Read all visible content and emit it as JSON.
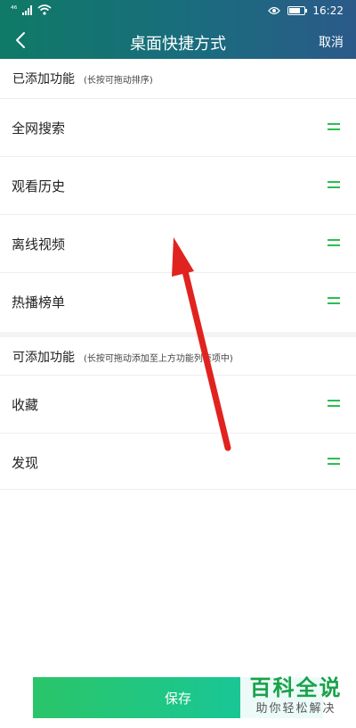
{
  "status_bar": {
    "network": "⁴⁶",
    "time": "16:22"
  },
  "navbar": {
    "title": "桌面快捷方式",
    "cancel_label": "取消"
  },
  "added_section": {
    "title": "已添加功能",
    "hint": "(长按可拖动排序)",
    "items": [
      {
        "label": "全网搜索"
      },
      {
        "label": "观看历史"
      },
      {
        "label": "离线视频"
      },
      {
        "label": "热播榜单"
      }
    ]
  },
  "available_section": {
    "title": "可添加功能",
    "hint": "(长按可拖动添加至上方功能列表项中)",
    "items": [
      {
        "label": "收藏"
      },
      {
        "label": "发现"
      }
    ]
  },
  "save_label": "保存",
  "watermark": {
    "main": "百科全说",
    "sub": "助你轻松解决"
  },
  "colors": {
    "accent_green": "#2bbf4f",
    "header_start": "#0f7a66",
    "header_end": "#2b5a89",
    "annotation_arrow": "#e0231f"
  }
}
